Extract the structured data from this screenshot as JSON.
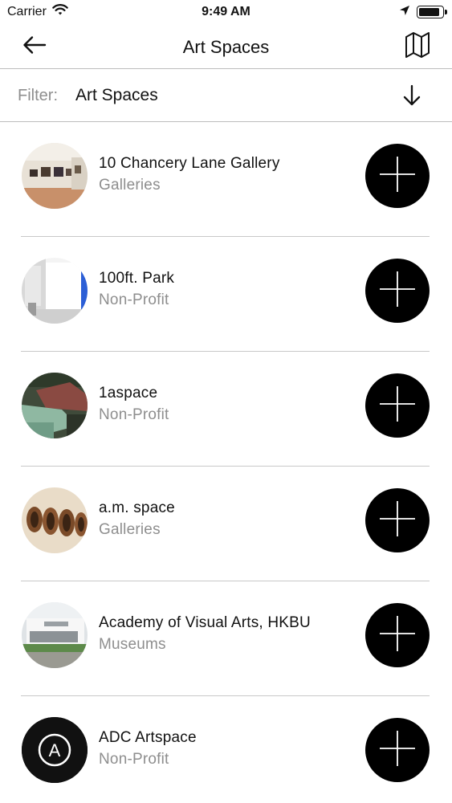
{
  "status_bar": {
    "carrier": "Carrier",
    "time": "9:49 AM",
    "wifi_icon": "wifi-icon",
    "location_icon": "location-arrow-icon",
    "battery_icon": "battery-icon",
    "battery_level": 0.9
  },
  "nav": {
    "title": "Art Spaces",
    "back_icon": "arrow-left-icon",
    "map_icon": "map-icon"
  },
  "filter": {
    "label": "Filter:",
    "value": "Art Spaces",
    "icon": "arrow-down-icon"
  },
  "spaces": [
    {
      "name": "10 Chancery Lane Gallery",
      "category": "Galleries",
      "thumb_icon": "gallery-interior-photo"
    },
    {
      "name": "100ft. Park",
      "category": "Non-Profit",
      "thumb_icon": "white-room-photo"
    },
    {
      "name": "1aspace",
      "category": "Non-Profit",
      "thumb_icon": "rooftops-photo"
    },
    {
      "name": "a.m. space",
      "category": "Galleries",
      "thumb_icon": "pipes-sculpture-photo"
    },
    {
      "name": "Academy of Visual Arts, HKBU",
      "category": "Museums",
      "thumb_icon": "building-exterior-photo"
    },
    {
      "name": "ADC Artspace",
      "category": "Non-Profit",
      "thumb_icon": "adc-logo",
      "thumb_text": "A"
    }
  ],
  "add_icon": "plus-icon",
  "colors": {
    "accent": "#000000",
    "secondary_text": "#8e8e8e",
    "divider": "#c8c8c8"
  }
}
